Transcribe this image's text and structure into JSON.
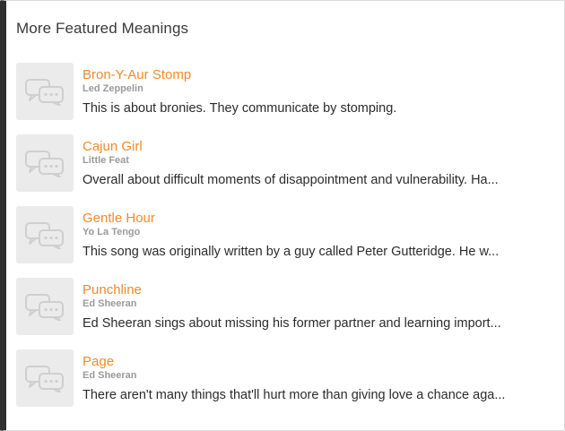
{
  "section": {
    "heading": "More Featured Meanings"
  },
  "items": [
    {
      "title": "Bron-Y-Aur Stomp",
      "artist": "Led Zeppelin",
      "excerpt": "This is about bronies. They communicate by stomping.",
      "icon": "speech-bubbles-icon"
    },
    {
      "title": "Cajun Girl",
      "artist": "Little Feat",
      "excerpt": "Overall about difficult moments of disappointment and vulnerability. Ha...",
      "icon": "speech-bubbles-icon"
    },
    {
      "title": "Gentle Hour",
      "artist": "Yo La Tengo",
      "excerpt": "This song was originally written by a guy called Peter Gutteridge. He w...",
      "icon": "speech-bubbles-icon"
    },
    {
      "title": "Punchline",
      "artist": "Ed Sheeran",
      "excerpt": "Ed Sheeran sings about missing his former partner and learning import...",
      "icon": "speech-bubbles-icon"
    },
    {
      "title": "Page",
      "artist": "Ed Sheeran",
      "excerpt": "There aren't many things that'll hurt more than giving love a chance aga...",
      "icon": "speech-bubbles-icon"
    }
  ],
  "colors": {
    "accent": "#f08a2c",
    "side_bar": "#2f2f2f",
    "thumbnail_bg": "#ebebeb",
    "artist_text": "#9a9a9a"
  }
}
